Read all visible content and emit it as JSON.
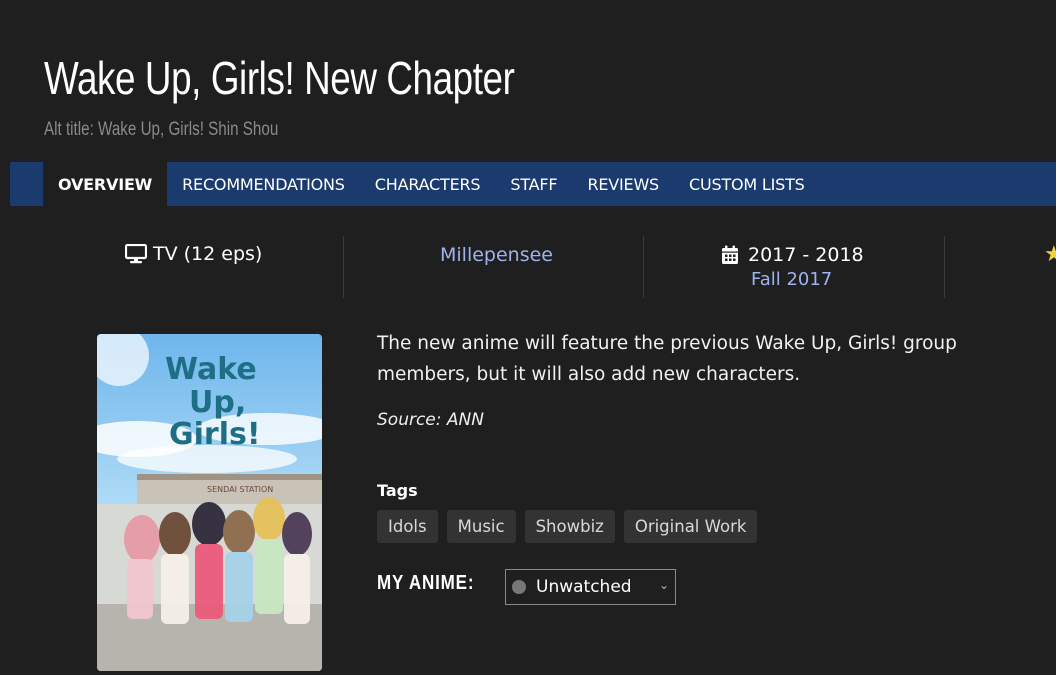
{
  "title": "Wake Up, Girls! New Chapter",
  "alt_title": "Alt title: Wake Up, Girls! Shin Shou",
  "tabs": [
    {
      "label": "OVERVIEW",
      "active": true
    },
    {
      "label": "RECOMMENDATIONS"
    },
    {
      "label": "CHARACTERS"
    },
    {
      "label": "STAFF"
    },
    {
      "label": "REVIEWS"
    },
    {
      "label": "CUSTOM LISTS"
    }
  ],
  "info": {
    "type": "TV (12 eps)",
    "type_icon": "tv-icon",
    "studio": "Millepensee",
    "years": "2017 - 2018",
    "years_icon": "calendar-icon",
    "season": "Fall 2017",
    "rating_icon": "star-icon"
  },
  "poster": {
    "logo_lines": [
      "Wake",
      "Up,",
      "Girls!"
    ],
    "station_sign": "SENDAI STATION"
  },
  "synopsis": "The new anime will feature the previous Wake Up, Girls! group members, but it will also add new characters.",
  "source": "Source: ANN",
  "tags_heading": "Tags",
  "tags": [
    "Idols",
    "Music",
    "Showbiz",
    "Original Work"
  ],
  "my_anime": {
    "label": "MY ANIME:",
    "status": "Unwatched"
  },
  "colors": {
    "background": "#1f1f1f",
    "nav": "#1b3a6e",
    "link": "#9fb3f0",
    "star": "#f1d43a"
  }
}
